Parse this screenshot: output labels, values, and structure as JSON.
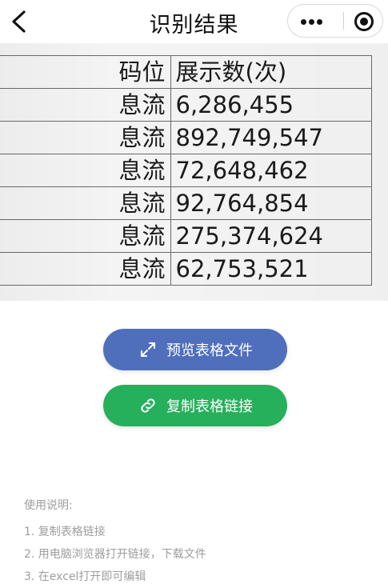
{
  "nav": {
    "title": "识别结果",
    "back_icon": "chevron-left-icon",
    "more_icon": "more-dots-icon",
    "close_icon": "target-close-icon"
  },
  "table": {
    "header": [
      "码位",
      "展示数(次)"
    ],
    "rows": [
      [
        "息流",
        "6,286,455"
      ],
      [
        "息流",
        "892,749,547"
      ],
      [
        "息流",
        "72,648,462"
      ],
      [
        "息流",
        "92,764,854"
      ],
      [
        "息流",
        "275,374,624"
      ],
      [
        "息流",
        "62,753,521"
      ]
    ]
  },
  "actions": {
    "preview_label": "预览表格文件",
    "preview_icon": "expand-arrows-icon",
    "preview_color": "#4f6fbd",
    "copy_label": "复制表格链接",
    "copy_icon": "link-icon",
    "copy_color": "#27b05c"
  },
  "usage": {
    "heading": "使用说明:",
    "steps": [
      "1. 复制表格链接",
      "2. 用电脑浏览器打开链接，下载文件",
      "3. 在excel打开即可编辑"
    ]
  }
}
